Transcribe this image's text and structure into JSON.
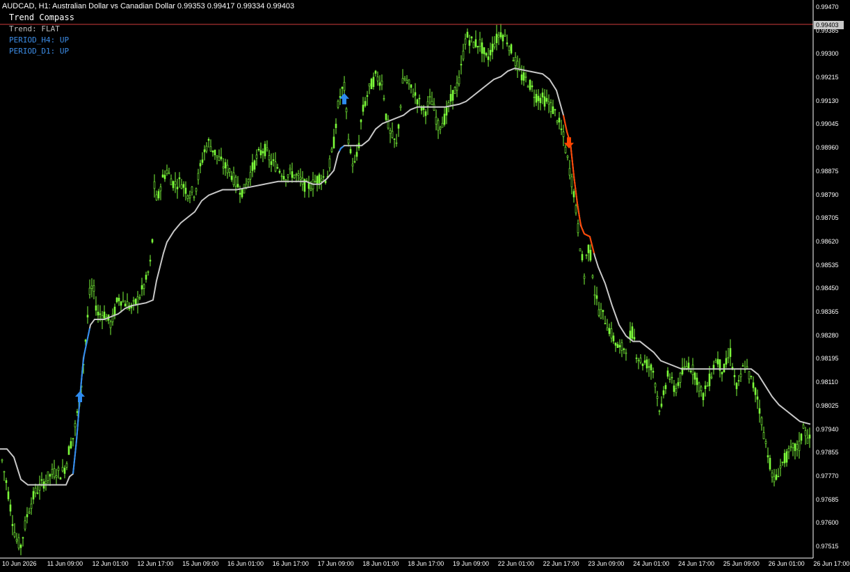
{
  "header": {
    "symbol": "AUDCAD",
    "timeframe": "H1",
    "description": "Australian Dollar vs Canadian Dollar",
    "ohlc": "0.99353 0.99417 0.99334 0.99403"
  },
  "indicator": {
    "title": "Trend Compass",
    "trend": "Trend: FLAT",
    "period_h4": "PERIOD_H4: UP",
    "period_d1": "PERIOD_D1: UP"
  },
  "colors": {
    "background": "#000000",
    "candles": "#7CFC3A",
    "ma_line": "#C8C8C8",
    "ma_up": "#2E8BEF",
    "ma_down": "#FF4500",
    "current_price_line": "#D23C3C",
    "indicator_blue": "#3C8CE6",
    "axis": "#FFFFFF"
  },
  "chart_data": {
    "type": "line",
    "title": "AUDCAD, H1: Australian Dollar vs Canadian Dollar",
    "current_price": "0.99403",
    "y_ticks": [
      "0.99470",
      "0.99385",
      "0.99300",
      "0.99215",
      "0.99130",
      "0.99045",
      "0.98960",
      "0.98875",
      "0.98790",
      "0.98705",
      "0.98620",
      "0.98535",
      "0.98450",
      "0.98365",
      "0.98280",
      "0.98195",
      "0.98110",
      "0.98025",
      "0.97940",
      "0.97855",
      "0.97770",
      "0.97685",
      "0.97600",
      "0.97515"
    ],
    "x_ticks": [
      "10 Jun 2026",
      "11 Jun 09:00",
      "12 Jun 01:00",
      "12 Jun 17:00",
      "15 Jun 09:00",
      "16 Jun 01:00",
      "16 Jun 17:00",
      "17 Jun 09:00",
      "18 Jun 01:00",
      "18 Jun 17:00",
      "19 Jun 09:00",
      "22 Jun 01:00",
      "22 Jun 17:00",
      "23 Jun 09:00",
      "24 Jun 01:00",
      "24 Jun 17:00",
      "25 Jun 09:00",
      "26 Jun 01:00",
      "26 Jun 17:00"
    ],
    "ylim": [
      0.9747,
      0.9948
    ],
    "price_path": [
      [
        0,
        0.9787
      ],
      [
        5,
        0.978
      ],
      [
        10,
        0.9774
      ],
      [
        15,
        0.9766
      ],
      [
        20,
        0.9758
      ],
      [
        25,
        0.9753
      ],
      [
        30,
        0.9752
      ],
      [
        40,
        0.9764
      ],
      [
        50,
        0.9771
      ],
      [
        60,
        0.9774
      ],
      [
        70,
        0.9777
      ],
      [
        80,
        0.9779
      ],
      [
        88,
        0.9778
      ],
      [
        95,
        0.9781
      ],
      [
        100,
        0.9788
      ],
      [
        105,
        0.9791
      ],
      [
        110,
        0.9798
      ],
      [
        115,
        0.9806
      ],
      [
        120,
        0.9818
      ],
      [
        125,
        0.9832
      ],
      [
        130,
        0.9846
      ],
      [
        135,
        0.9844
      ],
      [
        140,
        0.9836
      ],
      [
        150,
        0.9836
      ],
      [
        160,
        0.9832
      ],
      [
        170,
        0.9842
      ],
      [
        180,
        0.984
      ],
      [
        190,
        0.9838
      ],
      [
        200,
        0.9842
      ],
      [
        210,
        0.9848
      ],
      [
        218,
        0.9856
      ],
      [
        222,
        0.9882
      ],
      [
        226,
        0.9876
      ],
      [
        232,
        0.9884
      ],
      [
        240,
        0.9888
      ],
      [
        250,
        0.9883
      ],
      [
        260,
        0.9884
      ],
      [
        270,
        0.988
      ],
      [
        280,
        0.988
      ],
      [
        290,
        0.9891
      ],
      [
        295,
        0.9896
      ],
      [
        300,
        0.9898
      ],
      [
        310,
        0.9894
      ],
      [
        320,
        0.989
      ],
      [
        330,
        0.9888
      ],
      [
        340,
        0.9883
      ],
      [
        350,
        0.988
      ],
      [
        360,
        0.9887
      ],
      [
        370,
        0.9893
      ],
      [
        380,
        0.9896
      ],
      [
        390,
        0.9891
      ],
      [
        400,
        0.9889
      ],
      [
        410,
        0.9886
      ],
      [
        420,
        0.9887
      ],
      [
        430,
        0.9885
      ],
      [
        440,
        0.9882
      ],
      [
        450,
        0.9883
      ],
      [
        460,
        0.9886
      ],
      [
        470,
        0.9885
      ],
      [
        480,
        0.9898
      ],
      [
        485,
        0.991
      ],
      [
        490,
        0.9916
      ],
      [
        495,
        0.9918
      ],
      [
        500,
        0.9902
      ],
      [
        505,
        0.9892
      ],
      [
        510,
        0.989
      ],
      [
        515,
        0.9895
      ],
      [
        520,
        0.9908
      ],
      [
        530,
        0.9917
      ],
      [
        540,
        0.9922
      ],
      [
        550,
        0.992
      ],
      [
        555,
        0.9908
      ],
      [
        560,
        0.9902
      ],
      [
        570,
        0.9897
      ],
      [
        580,
        0.9922
      ],
      [
        590,
        0.9918
      ],
      [
        600,
        0.9914
      ],
      [
        610,
        0.9909
      ],
      [
        620,
        0.9914
      ],
      [
        630,
        0.9904
      ],
      [
        640,
        0.9907
      ],
      [
        650,
        0.9915
      ],
      [
        660,
        0.992
      ],
      [
        670,
        0.9937
      ],
      [
        680,
        0.9934
      ],
      [
        690,
        0.9934
      ],
      [
        700,
        0.9928
      ],
      [
        710,
        0.9934
      ],
      [
        720,
        0.9938
      ],
      [
        730,
        0.9935
      ],
      [
        740,
        0.9928
      ],
      [
        750,
        0.9922
      ],
      [
        760,
        0.992
      ],
      [
        770,
        0.9915
      ],
      [
        780,
        0.9914
      ],
      [
        790,
        0.9912
      ],
      [
        800,
        0.9908
      ],
      [
        810,
        0.99
      ],
      [
        815,
        0.9893
      ],
      [
        820,
        0.9887
      ],
      [
        825,
        0.988
      ],
      [
        830,
        0.9869
      ],
      [
        835,
        0.9859
      ],
      [
        840,
        0.985
      ],
      [
        845,
        0.9861
      ],
      [
        850,
        0.9856
      ],
      [
        855,
        0.9844
      ],
      [
        860,
        0.9838
      ],
      [
        870,
        0.9834
      ],
      [
        880,
        0.9828
      ],
      [
        890,
        0.9823
      ],
      [
        900,
        0.9824
      ],
      [
        910,
        0.983
      ],
      [
        915,
        0.9822
      ],
      [
        920,
        0.9819
      ],
      [
        930,
        0.9818
      ],
      [
        940,
        0.9815
      ],
      [
        945,
        0.9806
      ],
      [
        950,
        0.98
      ],
      [
        960,
        0.9815
      ],
      [
        970,
        0.9808
      ],
      [
        980,
        0.9814
      ],
      [
        990,
        0.9818
      ],
      [
        1000,
        0.9814
      ],
      [
        1010,
        0.9806
      ],
      [
        1020,
        0.9812
      ],
      [
        1030,
        0.982
      ],
      [
        1040,
        0.9815
      ],
      [
        1050,
        0.9822
      ],
      [
        1055,
        0.9814
      ],
      [
        1060,
        0.9808
      ],
      [
        1070,
        0.9818
      ],
      [
        1080,
        0.9812
      ],
      [
        1090,
        0.9805
      ],
      [
        1095,
        0.9797
      ],
      [
        1100,
        0.979
      ],
      [
        1105,
        0.9785
      ],
      [
        1110,
        0.9777
      ],
      [
        1115,
        0.9775
      ],
      [
        1120,
        0.978
      ],
      [
        1130,
        0.9784
      ],
      [
        1140,
        0.9787
      ],
      [
        1150,
        0.9788
      ],
      [
        1155,
        0.9796
      ],
      [
        1160,
        0.9791
      ],
      [
        1165,
        0.979
      ]
    ],
    "ma_path": [
      [
        0,
        0.9787
      ],
      [
        10,
        0.9787
      ],
      [
        20,
        0.9784
      ],
      [
        30,
        0.9776
      ],
      [
        40,
        0.9774
      ],
      [
        50,
        0.9774
      ],
      [
        60,
        0.9774
      ],
      [
        80,
        0.9774
      ],
      [
        95,
        0.9774
      ],
      [
        100,
        0.9777
      ],
      [
        105,
        0.9778
      ],
      [
        110,
        0.979
      ],
      [
        115,
        0.9806
      ],
      [
        120,
        0.982
      ],
      [
        125,
        0.9826
      ],
      [
        130,
        0.9832
      ],
      [
        136,
        0.9834
      ],
      [
        150,
        0.9834
      ],
      [
        160,
        0.9835
      ],
      [
        170,
        0.9836
      ],
      [
        180,
        0.9838
      ],
      [
        190,
        0.9839
      ],
      [
        210,
        0.984
      ],
      [
        220,
        0.9841
      ],
      [
        225,
        0.9848
      ],
      [
        230,
        0.9853
      ],
      [
        235,
        0.9858
      ],
      [
        240,
        0.9862
      ],
      [
        250,
        0.9866
      ],
      [
        260,
        0.9869
      ],
      [
        270,
        0.9871
      ],
      [
        280,
        0.9873
      ],
      [
        290,
        0.9877
      ],
      [
        300,
        0.9879
      ],
      [
        310,
        0.988
      ],
      [
        320,
        0.9881
      ],
      [
        340,
        0.9881
      ],
      [
        360,
        0.9882
      ],
      [
        380,
        0.9883
      ],
      [
        400,
        0.9884
      ],
      [
        420,
        0.9884
      ],
      [
        440,
        0.9884
      ],
      [
        450,
        0.9883
      ],
      [
        460,
        0.9883
      ],
      [
        470,
        0.9885
      ],
      [
        480,
        0.9888
      ],
      [
        486,
        0.9894
      ],
      [
        490,
        0.9896
      ],
      [
        495,
        0.9897
      ],
      [
        520,
        0.9897
      ],
      [
        530,
        0.9899
      ],
      [
        540,
        0.9903
      ],
      [
        550,
        0.9905
      ],
      [
        560,
        0.9906
      ],
      [
        570,
        0.9907
      ],
      [
        580,
        0.9908
      ],
      [
        590,
        0.991
      ],
      [
        600,
        0.9911
      ],
      [
        640,
        0.9911
      ],
      [
        660,
        0.9912
      ],
      [
        670,
        0.9913
      ],
      [
        680,
        0.9915
      ],
      [
        690,
        0.9917
      ],
      [
        700,
        0.9919
      ],
      [
        710,
        0.9921
      ],
      [
        720,
        0.9922
      ],
      [
        730,
        0.9924
      ],
      [
        740,
        0.9925
      ],
      [
        760,
        0.9924
      ],
      [
        780,
        0.9923
      ],
      [
        790,
        0.9921
      ],
      [
        800,
        0.9917
      ],
      [
        810,
        0.9908
      ],
      [
        815,
        0.9902
      ],
      [
        820,
        0.9898
      ],
      [
        825,
        0.9886
      ],
      [
        830,
        0.9876
      ],
      [
        835,
        0.9868
      ],
      [
        840,
        0.9865
      ],
      [
        848,
        0.9864
      ],
      [
        855,
        0.9857
      ],
      [
        860,
        0.9853
      ],
      [
        870,
        0.9847
      ],
      [
        880,
        0.9839
      ],
      [
        890,
        0.9832
      ],
      [
        900,
        0.9828
      ],
      [
        910,
        0.9826
      ],
      [
        920,
        0.9826
      ],
      [
        930,
        0.9824
      ],
      [
        940,
        0.9822
      ],
      [
        950,
        0.9819
      ],
      [
        960,
        0.9818
      ],
      [
        980,
        0.9816
      ],
      [
        1000,
        0.9816
      ],
      [
        1040,
        0.9816
      ],
      [
        1080,
        0.9816
      ],
      [
        1090,
        0.9814
      ],
      [
        1100,
        0.981
      ],
      [
        1110,
        0.9806
      ],
      [
        1120,
        0.9803
      ],
      [
        1130,
        0.9801
      ],
      [
        1140,
        0.9799
      ],
      [
        1150,
        0.9797
      ],
      [
        1165,
        0.9796
      ]
    ],
    "ma_up_segments": [
      [
        105,
        130
      ],
      [
        488,
        495
      ]
    ],
    "ma_down_segments": [
      [
        810,
        855
      ]
    ],
    "arrows": [
      {
        "x": 115,
        "price": 0.9806,
        "dir": "up"
      },
      {
        "x": 495,
        "price": 0.9914,
        "dir": "up"
      },
      {
        "x": 818,
        "price": 0.9898,
        "dir": "down"
      }
    ]
  }
}
